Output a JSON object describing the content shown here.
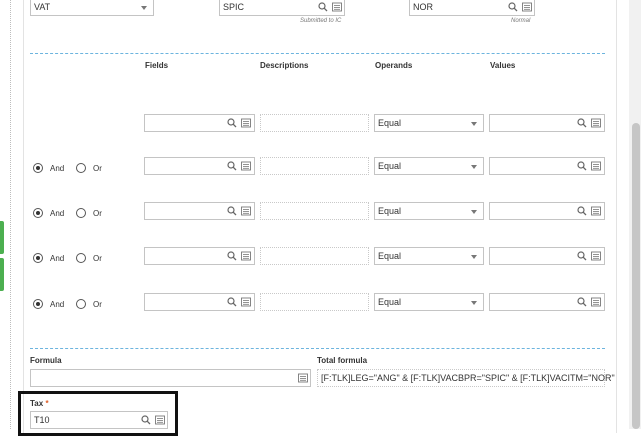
{
  "top_fields": {
    "vat_value": "VAT",
    "spic_value": "SPIC",
    "spic_caption": "Submitted to IC",
    "nor_value": "NOR",
    "nor_caption": "Normal"
  },
  "criteria_headers": {
    "fields": "Fields",
    "descriptions": "Descriptions",
    "operands": "Operands",
    "values": "Values"
  },
  "radio_labels": {
    "and": "And",
    "or": "Or"
  },
  "rows": [
    {
      "operand": "Equal"
    },
    {
      "operand": "Equal",
      "and_selected": true
    },
    {
      "operand": "Equal",
      "and_selected": true
    },
    {
      "operand": "Equal",
      "and_selected": true
    },
    {
      "operand": "Equal",
      "and_selected": true
    }
  ],
  "formula": {
    "label": "Formula",
    "value": "",
    "total_label": "Total formula",
    "total_value": "[F:TLK]LEG=\"ANG\" & [F:TLK]VACBPR=\"SPIC\" & [F:TLK]VACITM=\"NOR\""
  },
  "tax": {
    "label": "Tax",
    "required_mark": "*",
    "value": "T10"
  }
}
